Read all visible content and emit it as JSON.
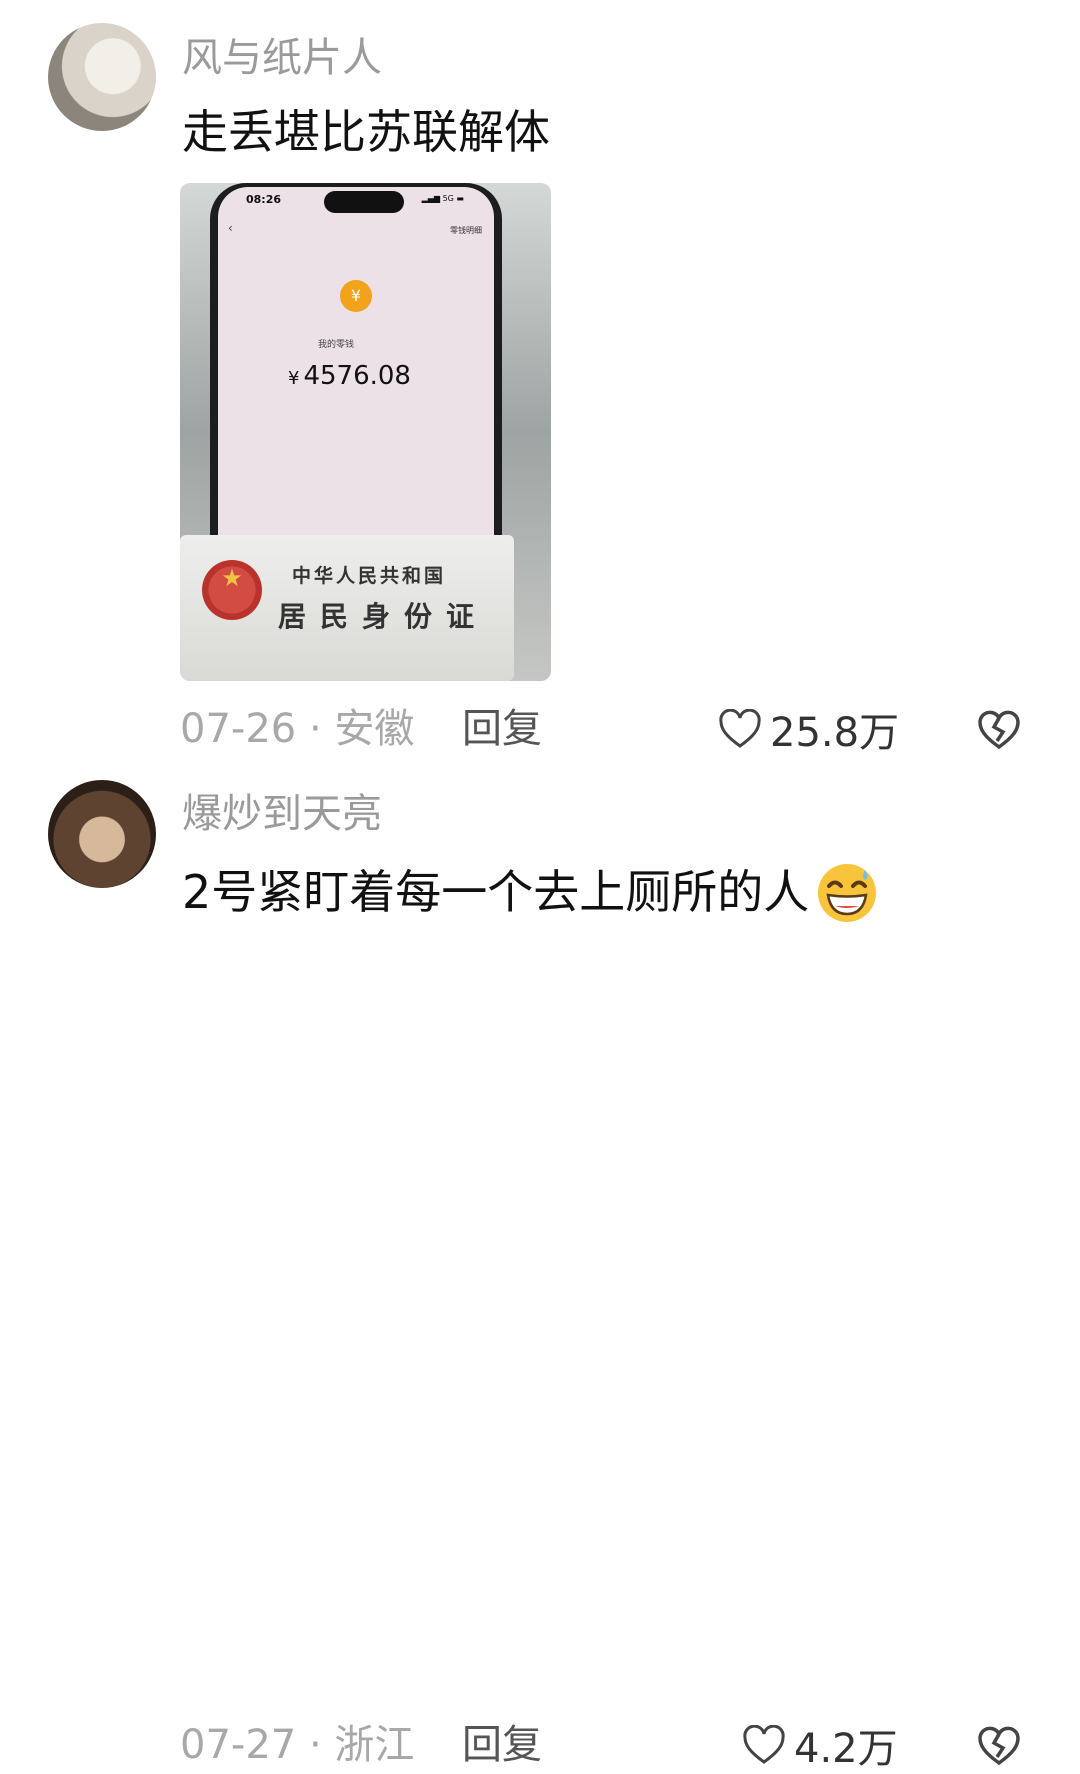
{
  "comments": [
    {
      "username": "风与纸片人",
      "text": "走丢堪比苏联解体",
      "photo": {
        "phone_time": "08:26",
        "signal": "5G",
        "detail_link": "零钱明细",
        "wallet_label": "我的零钱",
        "currency": "¥",
        "balance": "4576.08",
        "id_card_line1": "中华人民共和国",
        "id_card_line2": "居民身份证"
      },
      "date": "07-26",
      "location": "安徽",
      "meta": "07-26 · 安徽",
      "reply_label": "回复",
      "likes": "25.8万"
    },
    {
      "username": "爆炒到天亮",
      "text": "2号紧盯着每一个去上厕所的人",
      "emoji": "grinning-sweat-emoji",
      "date": "07-27",
      "location": "浙江",
      "meta": "07-27 · 浙江",
      "reply_label": "回复",
      "likes": "4.2万"
    }
  ]
}
